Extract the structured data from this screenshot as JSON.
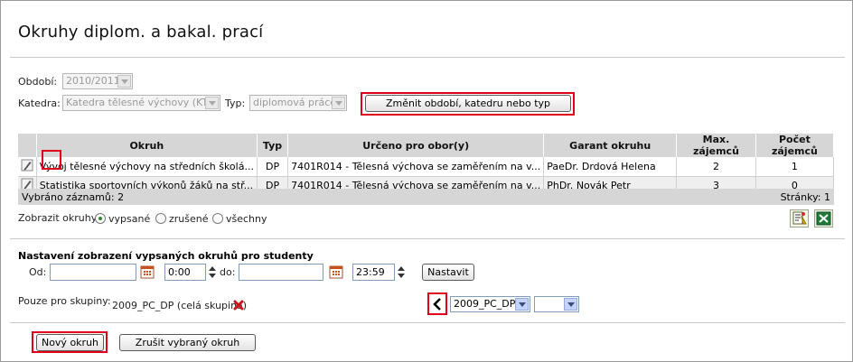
{
  "page": {
    "title": "Okruhy diplom. a bakal. prací"
  },
  "filters": {
    "period_label": "Období:",
    "period_value": "2010/2011",
    "department_label": "Katedra:",
    "department_value": "Katedra tělesné výchovy (KTV)",
    "type_label": "Typ:",
    "type_value": "diplomová práce",
    "change_button": "Změnit období, katedru nebo typ"
  },
  "table": {
    "columns": [
      "Okruh",
      "Typ",
      "Určeno pro obor(y)",
      "Garant okruhu",
      "Max. zájemců",
      "Počet zájemců"
    ],
    "rows": [
      {
        "topic": "Vývoj tělesné výchovy na středních školá...",
        "type": "DP",
        "field": "7401R014 - Tělesná výchova se zaměřením na v...",
        "guarantor": "PaeDr. Drdová Helena",
        "max": "2",
        "count": "1"
      },
      {
        "topic": "Statistika sportovních výkonů žáků na stř...",
        "type": "DP",
        "field": "7401R014 - Tělesná výchova se zaměřením na v...",
        "guarantor": "PhDr. Novák Petr",
        "max": "3",
        "count": "0"
      }
    ],
    "selected_label": "Vybráno záznamů: 2",
    "pages_label": "Stránky: 1"
  },
  "show": {
    "label": "Zobrazit okruhy",
    "options": [
      "vypsané",
      "zrušené",
      "všechny"
    ],
    "selected": "vypsané"
  },
  "settings": {
    "heading": "Nastavení zobrazení vypsaných okruhů pro studenty",
    "from_label": "Od:",
    "from_date": "",
    "from_time": "0:00",
    "to_label": "do:",
    "to_date": "",
    "to_time": "23:59",
    "set_button": "Nastavit"
  },
  "groups": {
    "label": "Pouze pro skupiny:",
    "item": "2009_PC_DP (celá skupina)",
    "select_value": "2009_PC_DP",
    "select2_value": ""
  },
  "actions": {
    "new_button": "Nový okruh",
    "cancel_button": "Zrušit vybraný okruh"
  },
  "colors": {
    "highlight": "#e0001b",
    "header_bg": "#d6d6d6"
  }
}
